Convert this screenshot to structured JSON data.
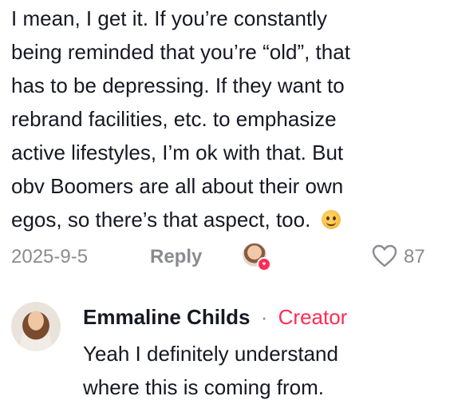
{
  "comment": {
    "lines": [
      "I mean, I get it. If you’re constantly",
      "being reminded that you’re “old”, that",
      "has to be depressing. If they want to",
      "rebrand facilities, etc. to emphasize",
      "active lifestyles, I’m ok with that. But",
      "obv Boomers are all about their own",
      "egos, so there’s that aspect, too."
    ],
    "emoji": "warm-smile-emoji",
    "date": "2025-9-5",
    "reply_label": "Reply",
    "like_count": "87",
    "liked_by_author_icon": "author-avatar-heart-badge",
    "like_icon": "heart-outline-icon"
  },
  "reply": {
    "author": "Emmaline Childs",
    "separator": "·",
    "badge": "Creator",
    "lines": [
      "Yeah I definitely understand",
      "where this is coming from."
    ]
  }
}
